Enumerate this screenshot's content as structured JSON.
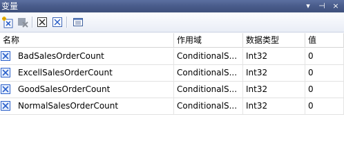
{
  "window": {
    "title": "变量"
  },
  "titlebar_controls": {
    "dropdown_icon": "▾",
    "pin_icon": "⊣",
    "close_icon": "×"
  },
  "columns": {
    "name": "名称",
    "scope": "作用域",
    "type": "数据类型",
    "value": "值"
  },
  "rows": [
    {
      "name": "BadSalesOrderCount",
      "scope": "ConditionalS...",
      "type": "Int32",
      "value": "0"
    },
    {
      "name": "ExcellSalesOrderCount",
      "scope": "ConditionalS...",
      "type": "Int32",
      "value": "0"
    },
    {
      "name": "GoodSalesOrderCount",
      "scope": "ConditionalS...",
      "type": "Int32",
      "value": "0"
    },
    {
      "name": "NormalSalesOrderCount",
      "scope": "ConditionalS...",
      "type": "Int32",
      "value": "0"
    }
  ],
  "colors": {
    "titlebar": "#4a5d8c",
    "icon_blue": "#2a5fc9",
    "toolbar_bg": "#e9edf6"
  }
}
